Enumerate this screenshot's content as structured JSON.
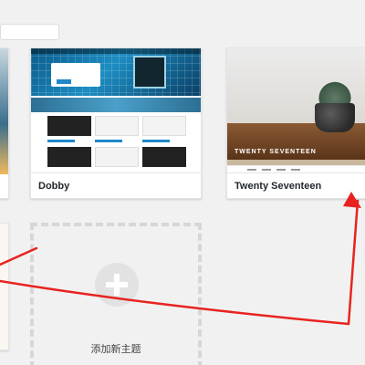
{
  "themes": [
    {
      "name": "Dobby"
    },
    {
      "name": "Twenty Seventeen",
      "preview_title": "TWENTY SEVENTEEN"
    }
  ],
  "add_new": {
    "label": "添加新主题"
  },
  "colors": {
    "annotation": "#e8231f",
    "accent": "#1e88c9"
  },
  "icons": {
    "add": "plus-icon"
  }
}
